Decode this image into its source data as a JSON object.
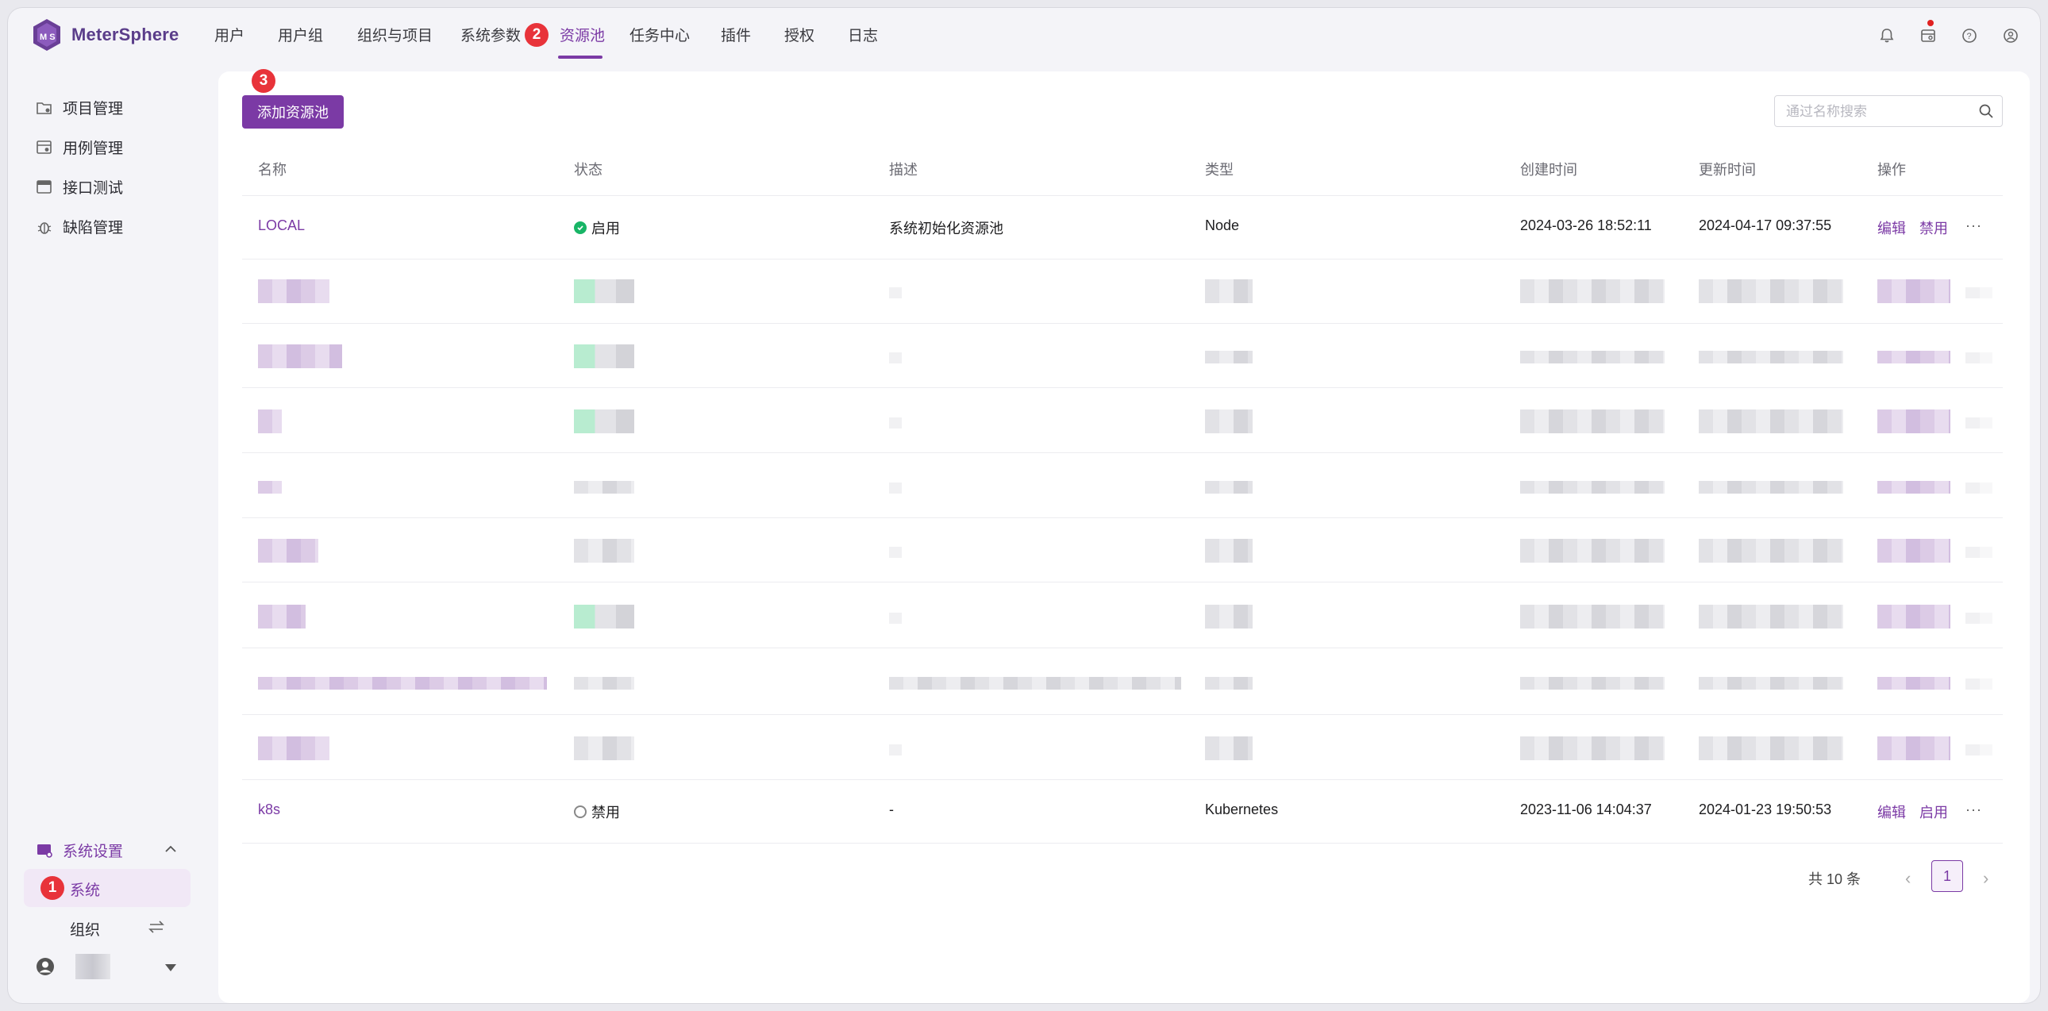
{
  "app": {
    "name": "MeterSphere"
  },
  "nav": {
    "items": [
      "用户",
      "用户组",
      "组织与项目",
      "系统参数",
      "资源池",
      "任务中心",
      "插件",
      "授权",
      "日志"
    ],
    "active": "资源池"
  },
  "sidebar": {
    "items": [
      {
        "label": "项目管理",
        "icon": "folder-settings-icon"
      },
      {
        "label": "用例管理",
        "icon": "case-icon"
      },
      {
        "label": "接口测试",
        "icon": "api-icon"
      },
      {
        "label": "缺陷管理",
        "icon": "bug-icon"
      }
    ],
    "settings_label": "系统设置",
    "system_label": "系统",
    "org_label": "组织"
  },
  "badges": [
    "1",
    "2",
    "3"
  ],
  "toolbar": {
    "add_label": "添加资源池",
    "search_placeholder": "通过名称搜索"
  },
  "table": {
    "columns": [
      "名称",
      "状态",
      "描述",
      "类型",
      "创建时间",
      "更新时间",
      "操作"
    ],
    "rows": [
      {
        "name": "LOCAL",
        "status": "启用",
        "desc": "系统初始化资源池",
        "type": "Node",
        "created": "2024-03-26 18:52:11",
        "updated": "2024-04-17 09:37:55",
        "action1": "编辑",
        "action2": "禁用",
        "more": "···"
      },
      {
        "name": "k8s",
        "status": "禁用",
        "desc": "-",
        "type": "Kubernetes",
        "created": "2023-11-06 14:04:37",
        "updated": "2024-01-23 19:50:53",
        "action1": "编辑",
        "action2": "启用",
        "more": "···"
      }
    ]
  },
  "pagination": {
    "total": "共 10 条",
    "page": "1",
    "prev": "‹",
    "next": "›"
  },
  "colors": {
    "accent": "#7b3aa5",
    "badge": "#e8333a",
    "ok": "#18b566"
  }
}
